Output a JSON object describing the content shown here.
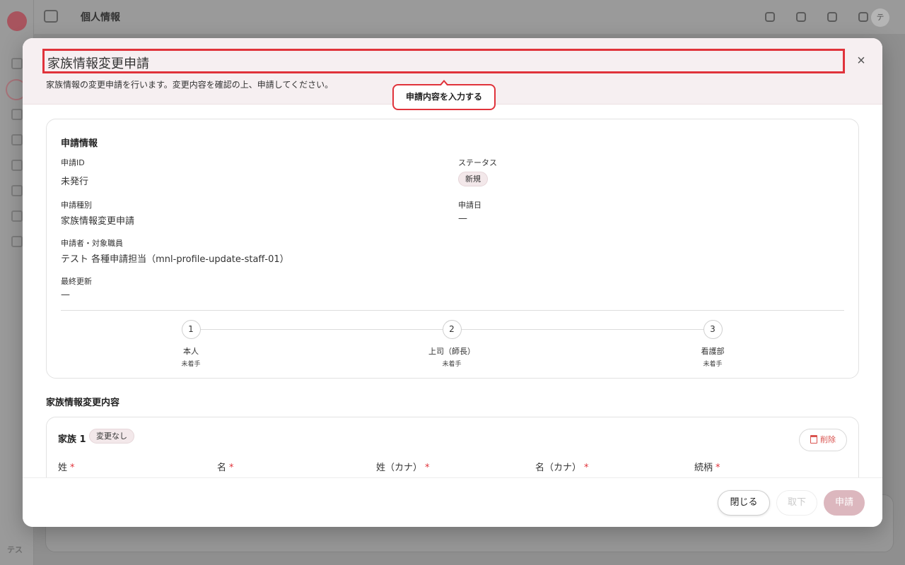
{
  "app": {
    "header_title": "個人情報",
    "sidebar_footer": "テス",
    "avatar_initial": "テ"
  },
  "modal": {
    "title": "家族情報変更申請",
    "description": "家族情報の変更申請を行います。変更内容を確認の上、申請してください。",
    "close_symbol": "×",
    "tooltip": "申請内容を入力する"
  },
  "info": {
    "section_title": "申請情報",
    "id_label": "申請ID",
    "id_value": "未発行",
    "status_label": "ステータス",
    "status_value": "新規",
    "type_label": "申請種別",
    "type_value": "家族情報変更申請",
    "date_label": "申請日",
    "date_value": "—",
    "applicant_label": "申請者・対象職員",
    "applicant_value": "テスト 各種申請担当（mnl-profile-update-staff-01）",
    "updated_label": "最終更新",
    "updated_value": "—"
  },
  "steps": [
    {
      "number": "1",
      "name": "本人",
      "status": "未着手"
    },
    {
      "number": "2",
      "name": "上司（師長）",
      "status": "未着手"
    },
    {
      "number": "3",
      "name": "看護部",
      "status": "未着手"
    }
  ],
  "content": {
    "section_title": "家族情報変更内容",
    "family_title": "家族 1",
    "family_badge": "変更なし",
    "delete_label": "削除",
    "required_mark": "*",
    "fields": [
      "姓",
      "名",
      "姓（カナ）",
      "名（カナ）",
      "続柄"
    ]
  },
  "footer": {
    "close_label": "閉じる",
    "withdraw_label": "取下",
    "submit_label": "申請"
  },
  "colors": {
    "accent": "#e0333b",
    "primary_button": "#dcb7be",
    "header_tint": "#f6eff1"
  }
}
